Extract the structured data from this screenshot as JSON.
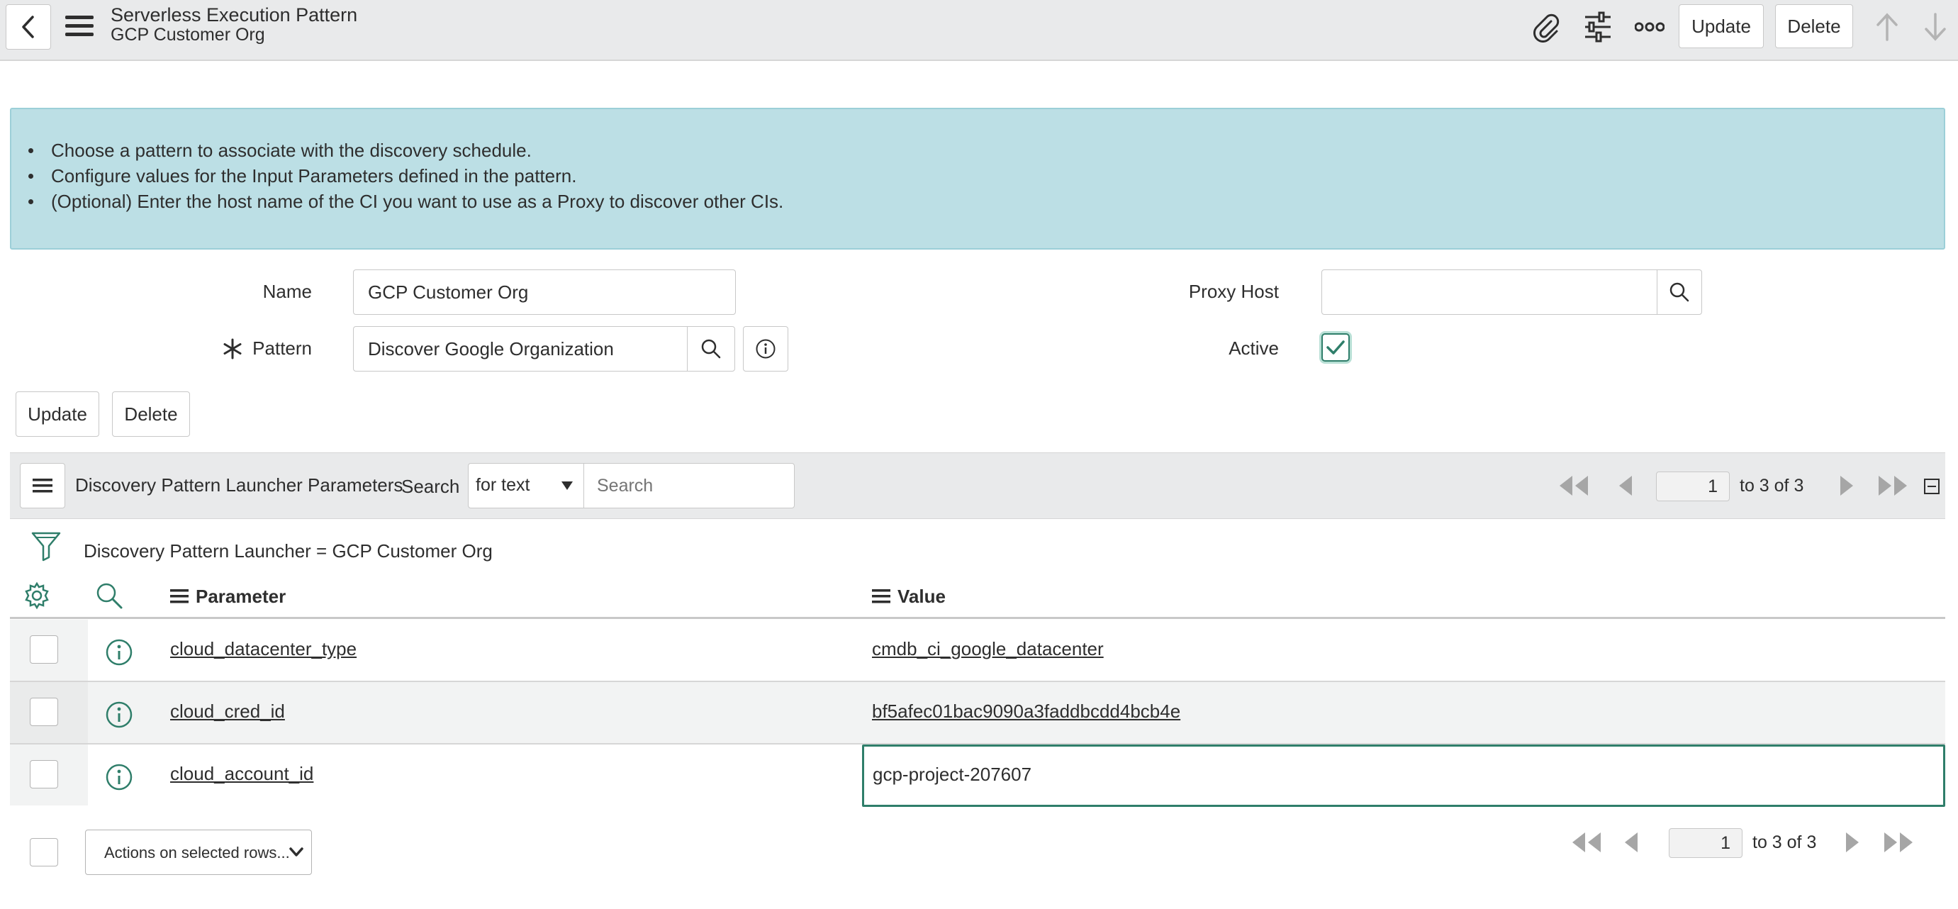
{
  "header": {
    "title": "Serverless Execution Pattern",
    "subtitle": "GCP Customer Org",
    "update_label": "Update",
    "delete_label": "Delete"
  },
  "banner": {
    "items": [
      "Choose a pattern to associate with the discovery schedule.",
      "Configure values for the Input Parameters defined in the pattern.",
      "(Optional) Enter the host name of the CI you want to use as a Proxy to discover other CIs."
    ],
    "bg_color": "#bcdfe5"
  },
  "form": {
    "name_label": "Name",
    "name_value": "GCP Customer Org",
    "pattern_label": "Pattern",
    "pattern_value": "Discover Google Organization",
    "proxy_label": "Proxy Host",
    "proxy_value": "",
    "active_label": "Active",
    "active_checked": true,
    "update_label": "Update",
    "delete_label": "Delete"
  },
  "list": {
    "title": "Discovery Pattern Launcher Parameters",
    "search_label": "Search",
    "search_mode": "for text",
    "search_placeholder": "Search",
    "page": "1",
    "range_text": "to 3 of 3",
    "filter_text": "Discovery Pattern Launcher = GCP Customer Org",
    "columns": [
      "Parameter",
      "Value"
    ],
    "rows": [
      {
        "parameter": "cloud_datacenter_type",
        "value": "cmdb_ci_google_datacenter"
      },
      {
        "parameter": "cloud_cred_id",
        "value": "bf5afec01bac9090a3faddbcdd4bcb4e"
      },
      {
        "parameter": "cloud_account_id",
        "value": "gcp-project-207607"
      }
    ],
    "actions_label": "Actions on selected rows...",
    "footer_page": "1",
    "footer_range_text": "to 3 of 3"
  },
  "colors": {
    "accent": "#2f7e6a",
    "header_bg": "#e9eaeb"
  }
}
